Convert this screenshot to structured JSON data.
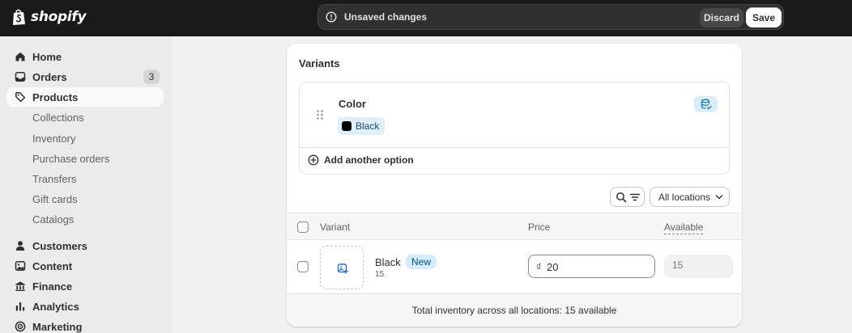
{
  "brand": {
    "name": "shopify"
  },
  "save_bar": {
    "message": "Unsaved changes",
    "discard_label": "Discard",
    "save_label": "Save"
  },
  "sidebar": {
    "items": [
      {
        "label": "Home",
        "icon": "home-icon"
      },
      {
        "label": "Orders",
        "icon": "inbox-icon",
        "badge": "3"
      },
      {
        "label": "Products",
        "icon": "tag-icon",
        "active": true
      },
      {
        "label": "Customers",
        "icon": "person-icon"
      },
      {
        "label": "Content",
        "icon": "content-icon"
      },
      {
        "label": "Finance",
        "icon": "bank-icon"
      },
      {
        "label": "Analytics",
        "icon": "bar-chart-icon"
      },
      {
        "label": "Marketing",
        "icon": "target-icon"
      }
    ],
    "product_subitems": [
      "Collections",
      "Inventory",
      "Purchase orders",
      "Transfers",
      "Gift cards",
      "Catalogs"
    ]
  },
  "variants_card": {
    "title": "Variants",
    "option": {
      "name": "Color",
      "values": [
        {
          "label": "Black",
          "swatch_color": "#000000"
        }
      ]
    },
    "add_option_label": "Add another option",
    "locations_label": "All locations",
    "table": {
      "headers": {
        "variant": "Variant",
        "price": "Price",
        "available": "Available"
      },
      "rows": [
        {
          "name": "Black",
          "badge": "New",
          "sub": "15",
          "currency": "₫",
          "price": "20",
          "available_placeholder": "15"
        }
      ]
    },
    "footer": "Total inventory across all locations: 15 available"
  },
  "colors": {
    "topbar": "#1a1a1a",
    "sidebar": "#ebebeb",
    "page": "#f1f1f1",
    "badge_new_bg": "#d5ebff",
    "chip_bg": "#e0f0fa"
  }
}
